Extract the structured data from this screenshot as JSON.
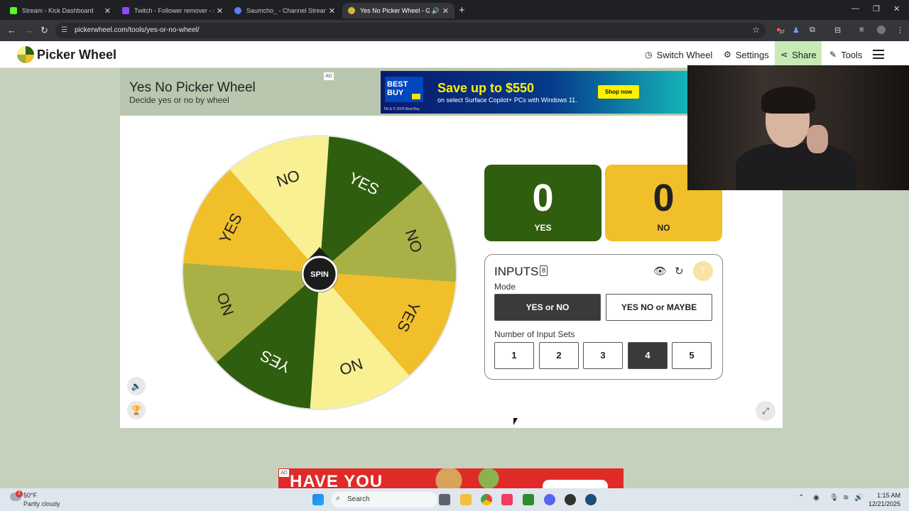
{
  "browser": {
    "tabs": [
      {
        "title": "Stream - Kick Dashboard",
        "favicon_color": "#53fc18"
      },
      {
        "title": "Twitch - Follower remover - sau",
        "favicon_color": "#9146ff"
      },
      {
        "title": "Saumcho_ - Channel Streams or",
        "favicon_color": "#5a7dff"
      },
      {
        "title": "Yes No Picker Wheel - Get Y",
        "favicon_color": "#d7b73c"
      }
    ],
    "url": "pickerwheel.com/tools/yes-or-no-wheel/",
    "extension_badge": "27"
  },
  "site": {
    "logo_text": "Picker Wheel",
    "nav": {
      "switch_wheel": "Switch Wheel",
      "settings": "Settings",
      "share": "Share",
      "tools": "Tools"
    }
  },
  "page": {
    "title": "Yes No Picker Wheel",
    "subtitle": "Decide yes or no by wheel",
    "ad_label": "AD"
  },
  "top_ad": {
    "brand_line1": "BEST",
    "brand_line2": "BUY",
    "headline": "Save up to $550",
    "subline": "on select Surface Copilot+ PCs with Windows 11.",
    "fineprint": "TM & © 2025 Best Buy",
    "cta": "Shop now"
  },
  "wheel": {
    "spin_label": "SPIN",
    "slices": [
      {
        "label": "YES",
        "color": "#2f5e0e"
      },
      {
        "label": "NO",
        "color": "#a9b146"
      },
      {
        "label": "YES",
        "color": "#f0bf2a"
      },
      {
        "label": "NO",
        "color": "#f8f092"
      },
      {
        "label": "YES",
        "color": "#2f5e0e"
      },
      {
        "label": "NO",
        "color": "#a9b146"
      },
      {
        "label": "YES",
        "color": "#f0bf2a"
      },
      {
        "label": "NO",
        "color": "#f8f092"
      }
    ]
  },
  "scores": {
    "yes": {
      "count": "0",
      "label": "YES"
    },
    "no": {
      "count": "0",
      "label": "NO"
    }
  },
  "inputs": {
    "title": "INPUTS",
    "count": "8",
    "avatar_letter": "T",
    "mode_label": "Mode",
    "modes": [
      "YES or NO",
      "YES NO or MAYBE"
    ],
    "selected_mode": "YES or NO",
    "sets_label": "Number of Input Sets",
    "sets": [
      "1",
      "2",
      "3",
      "4",
      "5"
    ],
    "selected_set": "4"
  },
  "bottom_ad": {
    "text": "HAVE YOU",
    "label": "AD"
  },
  "taskbar": {
    "weather_temp": "50°F",
    "weather_desc": "Partly cloudy",
    "weather_badge": "2",
    "search_label": "Search",
    "time": "1:15 AM",
    "date": "12/21/2025"
  }
}
